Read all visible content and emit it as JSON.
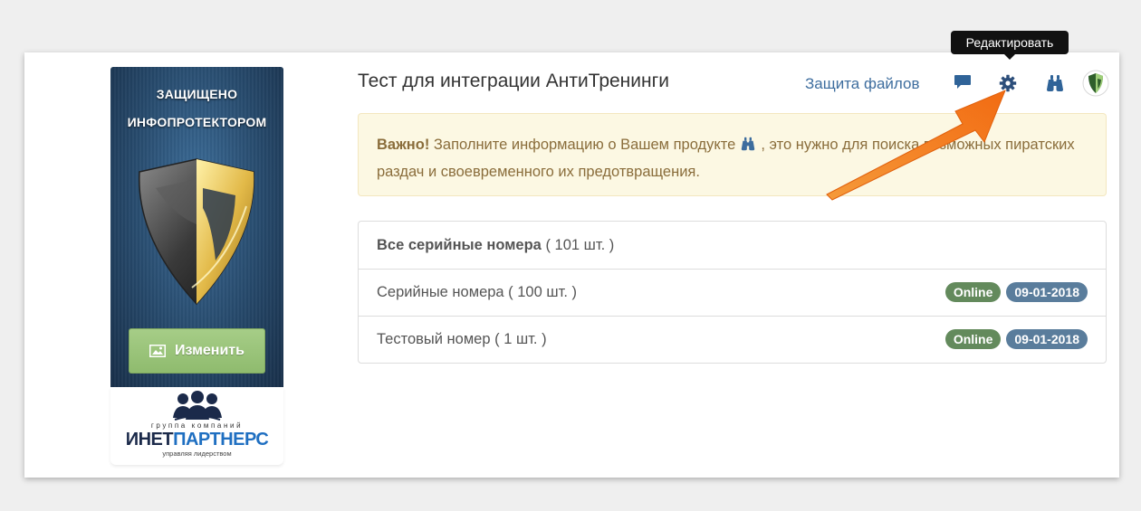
{
  "product": {
    "cover_line1": "ЗАЩИЩЕНО",
    "cover_line2": "ИНФОПРОТЕКТОРОМ",
    "change_button": "Изменить",
    "brand_group": "группа компаний",
    "brand_name_part1": "ИНЕТ",
    "brand_name_part2": "ПАРТНЕРС",
    "brand_motto": "управляя лидерством"
  },
  "header": {
    "title": "Тест для интеграции АнтиТренинги",
    "files_link": "Защита файлов",
    "tooltip": "Редактировать"
  },
  "alert": {
    "strong": "Важно!",
    "text_before_icon": " Заполните информацию о Вашем продукте",
    "text_after_icon": ", это нужно для поиска возможных пиратских раздач и своевременного их предотвращения."
  },
  "serials": {
    "all_label": "Все серийные номера",
    "all_count": " ( 101 шт. )",
    "items": [
      {
        "name": "Серийные номера ( 100 шт. )",
        "status": "Online",
        "date": "09-01-2018"
      },
      {
        "name": "Тестовый номер ( 1 шт. )",
        "status": "Online",
        "date": "09-01-2018"
      }
    ]
  },
  "colors": {
    "alert_bg": "#fcf8e3",
    "alert_text": "#8a6d3b",
    "link": "#3d6d9e",
    "badge_online": "#638a5c",
    "badge_date": "#5a7d9c",
    "change_button": "#9cc57c",
    "arrow": "#f47b20"
  },
  "icons": [
    "comment-icon",
    "gear-icon",
    "binoculars-icon",
    "shield-icon",
    "image-icon",
    "people-icon"
  ]
}
